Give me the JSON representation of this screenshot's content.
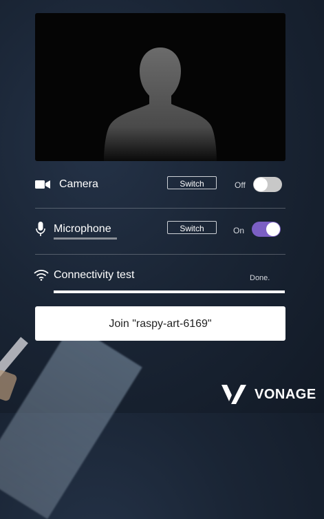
{
  "video": {
    "placeholder_icon": "person-silhouette"
  },
  "camera": {
    "label": "Camera",
    "icon": "video-camera-icon",
    "switch_label": "Switch",
    "state": "Off",
    "enabled": false
  },
  "microphone": {
    "label": "Microphone",
    "icon": "microphone-icon",
    "switch_label": "Switch",
    "state": "On",
    "enabled": true
  },
  "connectivity": {
    "label": "Connectivity test",
    "icon": "wifi-icon",
    "status": "Done.",
    "progress": 1.0
  },
  "join": {
    "label": "Join \"raspy-art-6169\""
  },
  "brand": {
    "name": "VONAGE"
  },
  "colors": {
    "toggle_on": "#7b5fc4",
    "toggle_off": "#c8c8c8"
  }
}
